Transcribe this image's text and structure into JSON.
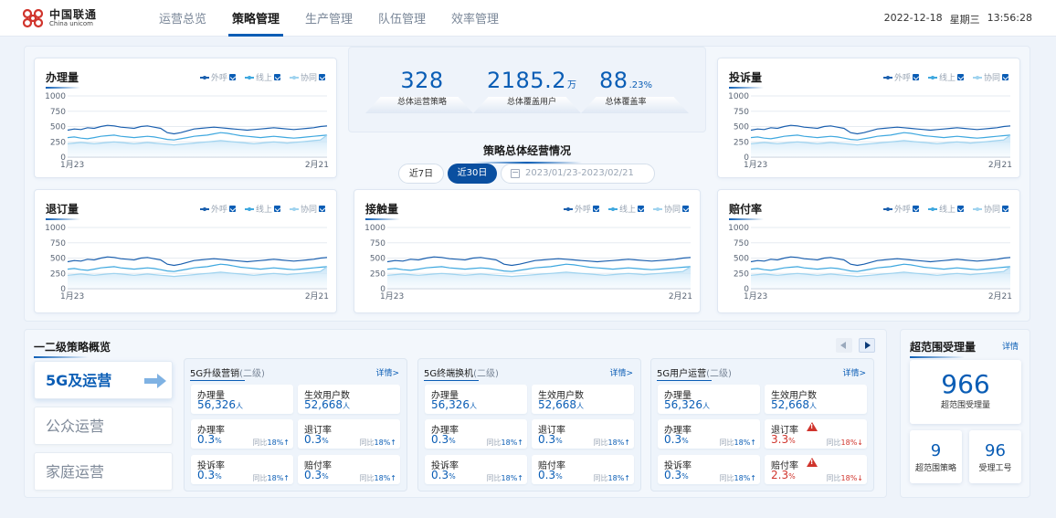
{
  "header": {
    "logo_cn": "中国联通",
    "logo_en": "China unicom",
    "tabs": [
      "运营总览",
      "策略管理",
      "生产管理",
      "队伍管理",
      "效率管理"
    ],
    "active_tab": "策略管理",
    "date": "2022-12-18",
    "weekday": "星期三",
    "time": "13:56:28"
  },
  "colors": {
    "primary": "#0a5db5",
    "series_1": "#1a5fae",
    "series_2": "#3fa8df",
    "series_3": "#9fd3ef",
    "alert": "#d0342c"
  },
  "legend": [
    "外呼",
    "线上",
    "协同"
  ],
  "summary": {
    "stats": [
      {
        "value": "328",
        "unit": "",
        "label": "总体运营策略"
      },
      {
        "value": "2185.2",
        "unit": "万",
        "label": "总体覆盖用户"
      },
      {
        "value": "88",
        "unit": ".23%",
        "label": "总体覆盖率"
      }
    ],
    "title": "策略总体经营情况",
    "btn_7": "近7日",
    "btn_30": "近30日",
    "date_range": "2023/01/23-2023/02/21"
  },
  "chart_data": [
    {
      "type": "line",
      "title": "办理量",
      "x_start": "1月23",
      "x_end": "2月21",
      "ylim": [
        0,
        1000
      ],
      "yticks": [
        0,
        250,
        500,
        750,
        1000
      ],
      "legend_position": "top-right",
      "series": [
        {
          "name": "外呼",
          "values": [
            440,
            460,
            450,
            480,
            470,
            500,
            520,
            510,
            490,
            480,
            470,
            500,
            510,
            490,
            470,
            400,
            380,
            400,
            430,
            460,
            470,
            480,
            490,
            480,
            470,
            460,
            450,
            440,
            450,
            460,
            470,
            480,
            470,
            460,
            450,
            460,
            470,
            480,
            500,
            510
          ]
        },
        {
          "name": "线上",
          "values": [
            320,
            330,
            310,
            300,
            320,
            340,
            350,
            360,
            340,
            330,
            320,
            330,
            340,
            330,
            310,
            290,
            280,
            300,
            320,
            340,
            350,
            360,
            380,
            400,
            390,
            370,
            350,
            340,
            330,
            320,
            330,
            340,
            330,
            320,
            310,
            320,
            330,
            340,
            350,
            360
          ]
        },
        {
          "name": "协同",
          "values": [
            220,
            230,
            240,
            230,
            220,
            230,
            240,
            250,
            240,
            230,
            220,
            230,
            240,
            230,
            220,
            210,
            200,
            210,
            220,
            230,
            240,
            250,
            260,
            270,
            260,
            250,
            240,
            230,
            220,
            230,
            240,
            250,
            240,
            230,
            240,
            250,
            260,
            270,
            280,
            360
          ]
        }
      ]
    },
    {
      "type": "line",
      "title": "投诉量",
      "x_start": "1月23",
      "x_end": "2月21",
      "ylim": [
        0,
        1000
      ],
      "yticks": [
        0,
        250,
        500,
        750,
        1000
      ],
      "legend_position": "top-right",
      "series": [
        {
          "name": "外呼",
          "values": [
            440,
            460,
            450,
            480,
            470,
            500,
            520,
            510,
            490,
            480,
            470,
            500,
            510,
            490,
            470,
            400,
            380,
            400,
            430,
            460,
            470,
            480,
            490,
            480,
            470,
            460,
            450,
            440,
            450,
            460,
            470,
            480,
            470,
            460,
            450,
            460,
            470,
            480,
            500,
            510
          ]
        },
        {
          "name": "线上",
          "values": [
            320,
            330,
            310,
            300,
            320,
            340,
            350,
            360,
            340,
            330,
            320,
            330,
            340,
            330,
            310,
            290,
            280,
            300,
            320,
            340,
            350,
            360,
            380,
            400,
            390,
            370,
            350,
            340,
            330,
            320,
            330,
            340,
            330,
            320,
            310,
            320,
            330,
            340,
            350,
            360
          ]
        },
        {
          "name": "协同",
          "values": [
            220,
            230,
            240,
            230,
            220,
            230,
            240,
            250,
            240,
            230,
            220,
            230,
            240,
            230,
            220,
            210,
            200,
            210,
            220,
            230,
            240,
            250,
            260,
            270,
            260,
            250,
            240,
            230,
            220,
            230,
            240,
            250,
            240,
            230,
            240,
            250,
            260,
            270,
            280,
            360
          ]
        }
      ]
    },
    {
      "type": "line",
      "title": "退订量",
      "x_start": "1月23",
      "x_end": "2月21",
      "ylim": [
        0,
        1000
      ],
      "yticks": [
        0,
        250,
        500,
        750,
        1000
      ],
      "legend_position": "top-right",
      "series": [
        {
          "name": "外呼",
          "values": [
            440,
            460,
            450,
            480,
            470,
            500,
            520,
            510,
            490,
            480,
            470,
            500,
            510,
            490,
            470,
            400,
            380,
            400,
            430,
            460,
            470,
            480,
            490,
            480,
            470,
            460,
            450,
            440,
            450,
            460,
            470,
            480,
            470,
            460,
            450,
            460,
            470,
            480,
            500,
            510
          ]
        },
        {
          "name": "线上",
          "values": [
            320,
            330,
            310,
            300,
            320,
            340,
            350,
            360,
            340,
            330,
            320,
            330,
            340,
            330,
            310,
            290,
            280,
            300,
            320,
            340,
            350,
            360,
            380,
            400,
            390,
            370,
            350,
            340,
            330,
            320,
            330,
            340,
            330,
            320,
            310,
            320,
            330,
            340,
            350,
            360
          ]
        },
        {
          "name": "协同",
          "values": [
            220,
            230,
            240,
            230,
            220,
            230,
            240,
            250,
            240,
            230,
            220,
            230,
            240,
            230,
            220,
            210,
            200,
            210,
            220,
            230,
            240,
            250,
            260,
            270,
            260,
            250,
            240,
            230,
            220,
            230,
            240,
            250,
            240,
            230,
            240,
            250,
            260,
            270,
            280,
            360
          ]
        }
      ]
    },
    {
      "type": "line",
      "title": "接触量",
      "x_start": "1月23",
      "x_end": "2月21",
      "ylim": [
        0,
        1000
      ],
      "yticks": [
        0,
        250,
        500,
        750,
        1000
      ],
      "legend_position": "top-right",
      "series": [
        {
          "name": "外呼",
          "values": [
            440,
            460,
            450,
            480,
            470,
            500,
            520,
            510,
            490,
            480,
            470,
            500,
            510,
            490,
            470,
            400,
            380,
            400,
            430,
            460,
            470,
            480,
            490,
            480,
            470,
            460,
            450,
            440,
            450,
            460,
            470,
            480,
            470,
            460,
            450,
            460,
            470,
            480,
            500,
            510
          ]
        },
        {
          "name": "线上",
          "values": [
            320,
            330,
            310,
            300,
            320,
            340,
            350,
            360,
            340,
            330,
            320,
            330,
            340,
            330,
            310,
            290,
            280,
            300,
            320,
            340,
            350,
            360,
            380,
            400,
            390,
            370,
            350,
            340,
            330,
            320,
            330,
            340,
            330,
            320,
            310,
            320,
            330,
            340,
            350,
            360
          ]
        },
        {
          "name": "协同",
          "values": [
            220,
            230,
            240,
            230,
            220,
            230,
            240,
            250,
            240,
            230,
            220,
            230,
            240,
            230,
            220,
            210,
            200,
            210,
            220,
            230,
            240,
            250,
            260,
            270,
            260,
            250,
            240,
            230,
            220,
            230,
            240,
            250,
            240,
            230,
            240,
            250,
            260,
            270,
            280,
            360
          ]
        }
      ]
    },
    {
      "type": "line",
      "title": "赔付率",
      "x_start": "1月23",
      "x_end": "2月21",
      "ylim": [
        0,
        1000
      ],
      "yticks": [
        0,
        250,
        500,
        750,
        1000
      ],
      "legend_position": "top-right",
      "series": [
        {
          "name": "外呼",
          "values": [
            440,
            460,
            450,
            480,
            470,
            500,
            520,
            510,
            490,
            480,
            470,
            500,
            510,
            490,
            470,
            400,
            380,
            400,
            430,
            460,
            470,
            480,
            490,
            480,
            470,
            460,
            450,
            440,
            450,
            460,
            470,
            480,
            470,
            460,
            450,
            460,
            470,
            480,
            500,
            510
          ]
        },
        {
          "name": "线上",
          "values": [
            320,
            330,
            310,
            300,
            320,
            340,
            350,
            360,
            340,
            330,
            320,
            330,
            340,
            330,
            310,
            290,
            280,
            300,
            320,
            340,
            350,
            360,
            380,
            400,
            390,
            370,
            350,
            340,
            330,
            320,
            330,
            340,
            330,
            320,
            310,
            320,
            330,
            340,
            350,
            360
          ]
        },
        {
          "name": "协同",
          "values": [
            220,
            230,
            240,
            230,
            220,
            230,
            240,
            250,
            240,
            230,
            220,
            230,
            240,
            230,
            220,
            210,
            200,
            210,
            220,
            230,
            240,
            250,
            260,
            270,
            260,
            250,
            240,
            230,
            220,
            230,
            240,
            250,
            240,
            230,
            240,
            250,
            260,
            270,
            280,
            360
          ]
        }
      ]
    }
  ],
  "overview": {
    "title": "一二级策略概览",
    "categories": [
      "5G及运营",
      "公众运营",
      "家庭运营"
    ],
    "strategies": [
      {
        "name": "5G升级营销",
        "level": "(二级)",
        "link": "详情>",
        "m1": {
          "label": "办理量",
          "value": "56,326",
          "unit": "人"
        },
        "m2": {
          "label": "生效用户数",
          "value": "52,668",
          "unit": "人"
        },
        "m3": {
          "label": "办理率",
          "value": "0.3",
          "unit": "%",
          "cmp": "同比",
          "pct": "18%↑"
        },
        "m4": {
          "label": "退订率",
          "value": "0.3",
          "unit": "%",
          "cmp": "同比",
          "pct": "18%↑"
        },
        "m5": {
          "label": "投诉率",
          "value": "0.3",
          "unit": "%",
          "cmp": "同比",
          "pct": "18%↑"
        },
        "m6": {
          "label": "赔付率",
          "value": "0.3",
          "unit": "%",
          "cmp": "同比",
          "pct": "18%↑"
        }
      },
      {
        "name": "5G终端换机",
        "level": "(二级)",
        "link": "详情>",
        "m1": {
          "label": "办理量",
          "value": "56,326",
          "unit": "人"
        },
        "m2": {
          "label": "生效用户数",
          "value": "52,668",
          "unit": "人"
        },
        "m3": {
          "label": "办理率",
          "value": "0.3",
          "unit": "%",
          "cmp": "同比",
          "pct": "18%↑"
        },
        "m4": {
          "label": "退订率",
          "value": "0.3",
          "unit": "%",
          "cmp": "同比",
          "pct": "18%↑"
        },
        "m5": {
          "label": "投诉率",
          "value": "0.3",
          "unit": "%",
          "cmp": "同比",
          "pct": "18%↑"
        },
        "m6": {
          "label": "赔付率",
          "value": "0.3",
          "unit": "%",
          "cmp": "同比",
          "pct": "18%↑"
        }
      },
      {
        "name": "5G用户运营",
        "level": "(二级)",
        "link": "详情>",
        "m1": {
          "label": "办理量",
          "value": "56,326",
          "unit": "人"
        },
        "m2": {
          "label": "生效用户数",
          "value": "52,668",
          "unit": "人"
        },
        "m3": {
          "label": "办理率",
          "value": "0.3",
          "unit": "%",
          "cmp": "同比",
          "pct": "18%↑"
        },
        "m4": {
          "label": "退订率",
          "value": "3.3",
          "unit": "%",
          "cmp": "同比",
          "pct": "18%↓"
        },
        "m5": {
          "label": "投诉率",
          "value": "0.3",
          "unit": "%",
          "cmp": "同比",
          "pct": "18%↑"
        },
        "m6": {
          "label": "赔付率",
          "value": "2.3",
          "unit": "%",
          "cmp": "同比",
          "pct": "18%↓"
        }
      }
    ]
  },
  "ultra": {
    "title": "超范围受理量",
    "link": "详情",
    "main": {
      "value": "966",
      "label": "超范围受理量"
    },
    "strategies": {
      "value": "9",
      "label": "超范围策略"
    },
    "workers": {
      "value": "96",
      "label": "受理工号"
    }
  }
}
